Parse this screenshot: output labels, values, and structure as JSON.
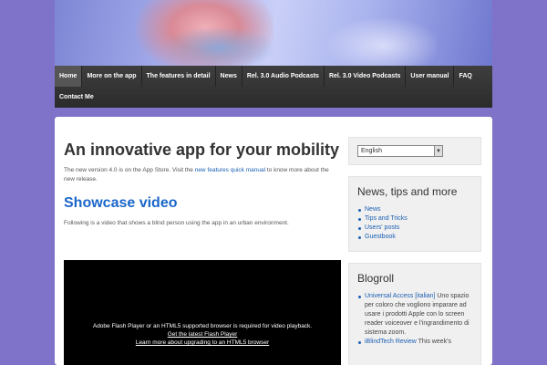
{
  "nav": {
    "items": [
      "Home",
      "More on the app",
      "The features in detail",
      "News",
      "Rel. 3.0 Audio Podcasts",
      "Rel. 3.0 Video Podcasts",
      "User manual",
      "FAQ"
    ],
    "items_row2": [
      "Contact Me"
    ],
    "active": "Home"
  },
  "main": {
    "title": "An innovative app for your mobility",
    "intro_before": "The new version 4.0 is on the App Store. Visit the",
    "intro_link": "new features quick manual",
    "intro_after": "to know more about the new release.",
    "showcase_heading": "Showcase video",
    "showcase_text": "Following is a video that shows a blind person using the app in an urban environment.",
    "video": {
      "message": "Adobe Flash Player or an HTML5 supported browser is required for video playback.",
      "link1": "Get the latest Flash Player",
      "link2": "Learn more about upgrading to an HTML5 browser"
    }
  },
  "sidebar": {
    "language": "English",
    "news_title": "News, tips and more",
    "news_links": [
      "News",
      "Tips and Tricks",
      "Users' posts",
      "Guestbook"
    ],
    "blogroll_title": "Blogroll",
    "blogroll": [
      {
        "link": "Universal Access [italian]",
        "text": "Uno spazio per coloro che vogliono imparare ad usare i prodotti Apple con lo screen reader voiceover e l'ingrandimento di sistema zoom."
      },
      {
        "link": "iBlindTech Review",
        "text": "This week's"
      }
    ]
  },
  "colors": {
    "background": "#7e73c9",
    "nav": "#333333",
    "link": "#1a5fb4",
    "heading_blue": "#1b66c9"
  }
}
